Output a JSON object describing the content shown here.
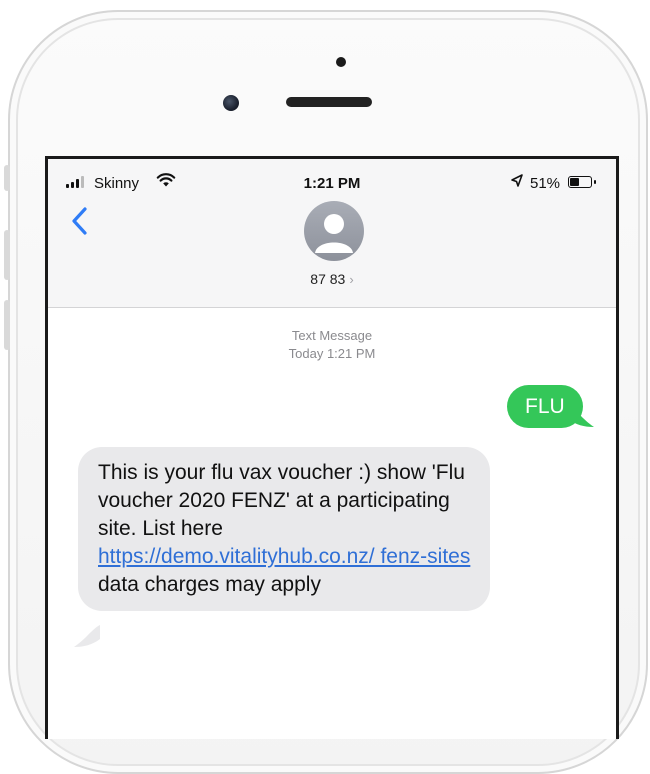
{
  "status_bar": {
    "carrier": "Skinny",
    "time": "1:21 PM",
    "battery": "51%",
    "battery_level": 0.51
  },
  "header": {
    "contact": "87 83",
    "contact_chevron": "›"
  },
  "thread": {
    "meta_label": "Text Message",
    "meta_time": "Today 1:21 PM"
  },
  "messages": {
    "outgoing": "FLU",
    "incoming_text_1": "This is your flu vax voucher :) show 'Flu voucher 2020 FENZ' at a participating site. List here ",
    "incoming_link": "https://demo.vitalityhub.co.nz/ fenz-sites",
    "incoming_text_2": " data charges may apply"
  },
  "colors": {
    "outgoing_bubble": "#34c759",
    "incoming_bubble": "#e9e9eb",
    "link": "#2f6fd6",
    "back_chevron": "#2f7cf6"
  },
  "icons": [
    "signal-bars-icon",
    "wifi-icon",
    "location-arrow-icon",
    "battery-icon",
    "back-chevron-icon",
    "contact-avatar-icon"
  ]
}
